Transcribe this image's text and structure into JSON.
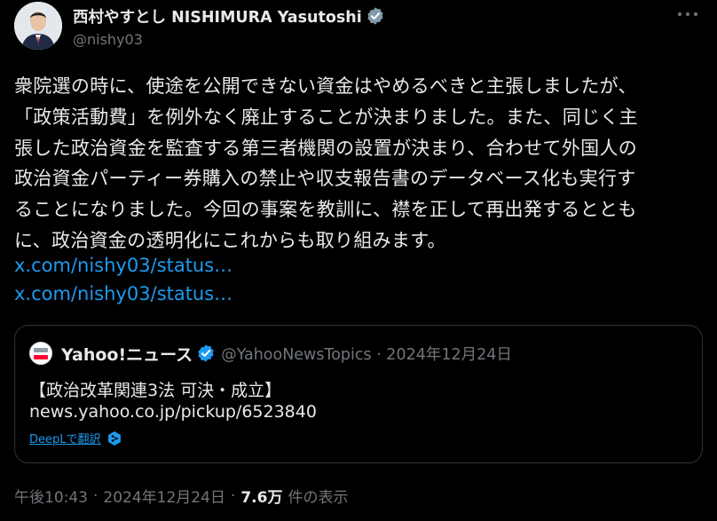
{
  "author": {
    "display_name": "西村やすとし NISHIMURA Yasutoshi",
    "handle": "@nishy03"
  },
  "post": {
    "lines": [
      "衆院選の時に、使途を公開できない資金はやめるべきと主張しましたが、",
      "「政策活動費」を例外なく廃止することが決まりました。また、同じく主",
      "張した政治資金を監査する第三者機関の設置が決まり、合わせて外国人の",
      "政治資金パーティー券購入の禁止や収支報告書のデータベース化も実行す",
      "ることになりました。今回の事案を教訓に、襟を正して再出発するととも",
      "に、政治資金の透明化にこれからも取り組みます。"
    ],
    "links": [
      "x.com/nishy03/status…",
      "x.com/nishy03/status…"
    ]
  },
  "quote": {
    "name": "Yahoo!ニュース",
    "handle_date": "@YahooNewsTopics · 2024年12月24日",
    "title": "【政治改革関連3法 可決・成立】",
    "url": "news.yahoo.co.jp/pickup/6523840",
    "translate_label": "DeepLで翻訳"
  },
  "meta": {
    "time": "午後10:43",
    "date": "2024年12月24日",
    "views": "7.6万",
    "views_label": "件の表示"
  },
  "colors": {
    "background": "#000000",
    "text": "#e7e9ea",
    "muted": "#71767b",
    "link": "#1d9bf0",
    "verified": "#829aab"
  },
  "icons": {
    "verified": "verified-badge-icon",
    "more": "more-icon",
    "deepl": "deepl-icon"
  }
}
